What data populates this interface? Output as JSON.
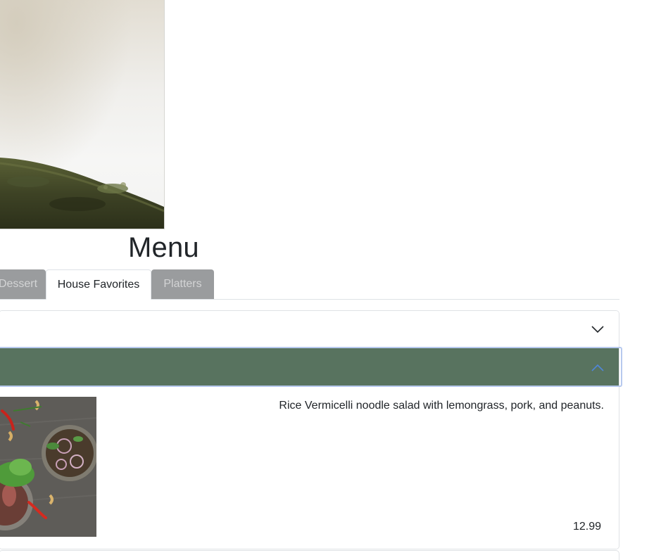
{
  "hero": {
    "image_name": "moss-branch-photo"
  },
  "menu": {
    "title": "Menu"
  },
  "tabs": [
    {
      "label": "Dessert",
      "state": "inactive"
    },
    {
      "label": "House Favorites",
      "state": "active"
    },
    {
      "label": "Platters",
      "state": "inactive"
    }
  ],
  "accordion": {
    "collapsed_icon": "chevron-down-icon",
    "expanded_icon": "chevron-up-icon",
    "expanded_header_color": "#58735f",
    "item": {
      "image_name": "noodle-salad-photo",
      "description": "Rice Vermicelli noodle salad with lemongrass, pork, and peanuts.",
      "price": "12.99"
    }
  },
  "colors": {
    "accent": "#58735f",
    "inactive_tab": "#9a9c9e",
    "chevron_active": "#4f86d9",
    "chevron_default": "#212529"
  }
}
